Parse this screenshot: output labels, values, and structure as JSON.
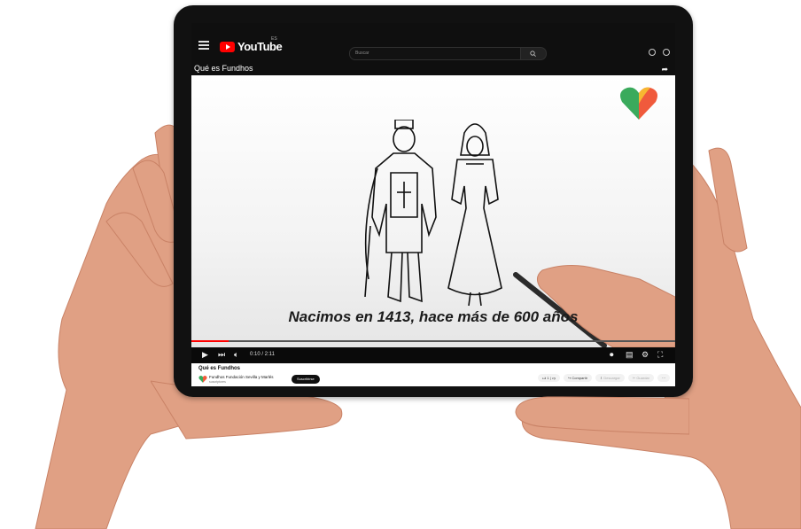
{
  "header": {
    "menu_icon": "hamburger-menu-icon",
    "logo_text": "YouTube",
    "region": "ES",
    "search_placeholder": "Buscar",
    "search_icon": "search-icon"
  },
  "video": {
    "title": "Qué es Fundhos",
    "caption": "Nacimos en 1413, hace más de 600 años",
    "time": "0:10 / 2:11",
    "progress_fraction": 0.077
  },
  "channel": {
    "name": "Fundhos Fundación Sevilla y Marlés",
    "subscribers": "suscriptores",
    "subscribe_label": "Suscribirse"
  },
  "actions": {
    "like_count": "1",
    "share_label": "Compartir",
    "download_label": "Descargar",
    "clip_label": "Guardar",
    "more_label": "···"
  },
  "colors": {
    "brand_red": "#ff0000",
    "dark_bg": "#0f0f0f",
    "skin": "#e0a084"
  }
}
